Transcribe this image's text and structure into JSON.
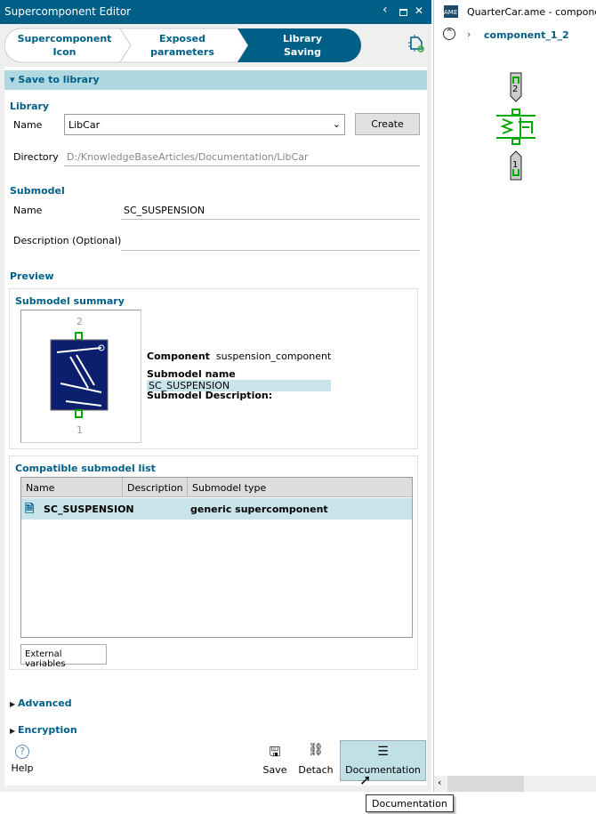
{
  "window": {
    "title": "Supercomponent Editor",
    "back_icon": "chevron-left-icon",
    "restore_icon": "restore-icon",
    "close_icon": "close-icon"
  },
  "steps": [
    {
      "label": "Supercomponent Icon"
    },
    {
      "label": "Exposed parameters"
    },
    {
      "label": "Library Saving",
      "active": true
    }
  ],
  "section": {
    "title": "Save to library"
  },
  "library": {
    "heading": "Library",
    "name_label": "Name",
    "name_value": "LibCar",
    "create_label": "Create",
    "directory_label": "Directory",
    "directory_value": "D:/KnowledgeBaseArticles/Documentation/LibCar"
  },
  "submodel": {
    "heading": "Submodel",
    "name_label": "Name",
    "name_value": "SC_SUSPENSION",
    "description_label": "Description (Optional)",
    "description_value": ""
  },
  "preview": {
    "heading": "Preview",
    "summary_title": "Submodel summary",
    "port_top": "2",
    "port_bottom": "1",
    "component_label": "Component",
    "component_value": "suspension_component",
    "submodel_name_label": "Submodel name",
    "submodel_name_value": "SC_SUSPENSION",
    "submodel_description_label": "Submodel Description:"
  },
  "compatible": {
    "title": "Compatible submodel list",
    "columns": [
      "Name",
      "Description",
      "Submodel type"
    ],
    "rows": [
      {
        "name": "SC_SUSPENSION",
        "description": "",
        "type": "generic supercomponent"
      }
    ],
    "external_variables_label": "External variables"
  },
  "collapsed": [
    {
      "label": "Advanced"
    },
    {
      "label": "Encryption"
    }
  ],
  "footer": {
    "help": "Help",
    "save": "Save",
    "detach": "Detach",
    "documentation": "Documentation"
  },
  "tooltip": "Documentation",
  "right_panel": {
    "title": "QuarterCar.ame - component",
    "breadcrumb": "component_1_2",
    "port_top": "2",
    "port_bottom": "1"
  },
  "colors": {
    "accent": "#005f87",
    "section": "#b0d8e0",
    "selection": "#c8e4ea",
    "green": "#00b000"
  }
}
